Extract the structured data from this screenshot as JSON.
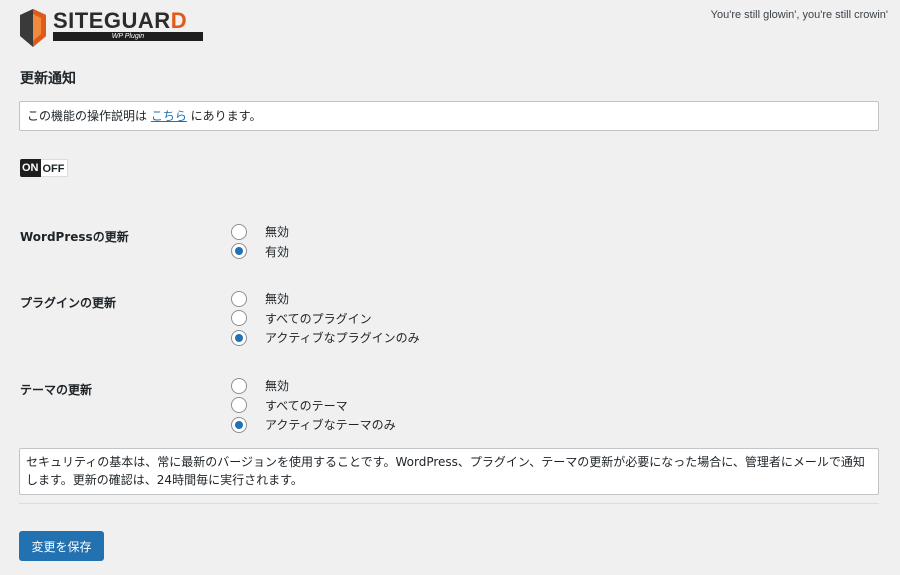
{
  "brand": {
    "name_main": "SITEGUAR",
    "name_tail": "D",
    "subtitle": "WP Plugin"
  },
  "hello_dolly": "You're still glowin', you're still crowin'",
  "page_title": "更新通知",
  "notice": {
    "before": "この機能の操作説明は ",
    "link": "こちら",
    "after": " にあります。"
  },
  "toggle": {
    "on": "ON",
    "off": "OFF",
    "state": "on"
  },
  "sections": [
    {
      "label": "WordPressの更新",
      "options": [
        {
          "label": "無効",
          "checked": false
        },
        {
          "label": "有効",
          "checked": true
        }
      ]
    },
    {
      "label": "プラグインの更新",
      "options": [
        {
          "label": "無効",
          "checked": false
        },
        {
          "label": "すべてのプラグイン",
          "checked": false
        },
        {
          "label": "アクティブなプラグインのみ",
          "checked": true
        }
      ]
    },
    {
      "label": "テーマの更新",
      "options": [
        {
          "label": "無効",
          "checked": false
        },
        {
          "label": "すべてのテーマ",
          "checked": false
        },
        {
          "label": "アクティブなテーマのみ",
          "checked": true
        }
      ]
    }
  ],
  "description": "セキュリティの基本は、常に最新のバージョンを使用することです。WordPress、プラグイン、テーマの更新が必要になった場合に、管理者にメールで通知します。更新の確認は、24時間毎に実行されます。",
  "save_label": "変更を保存",
  "colors": {
    "primary": "#2271b1",
    "logo_accent": "#e05a1a"
  }
}
